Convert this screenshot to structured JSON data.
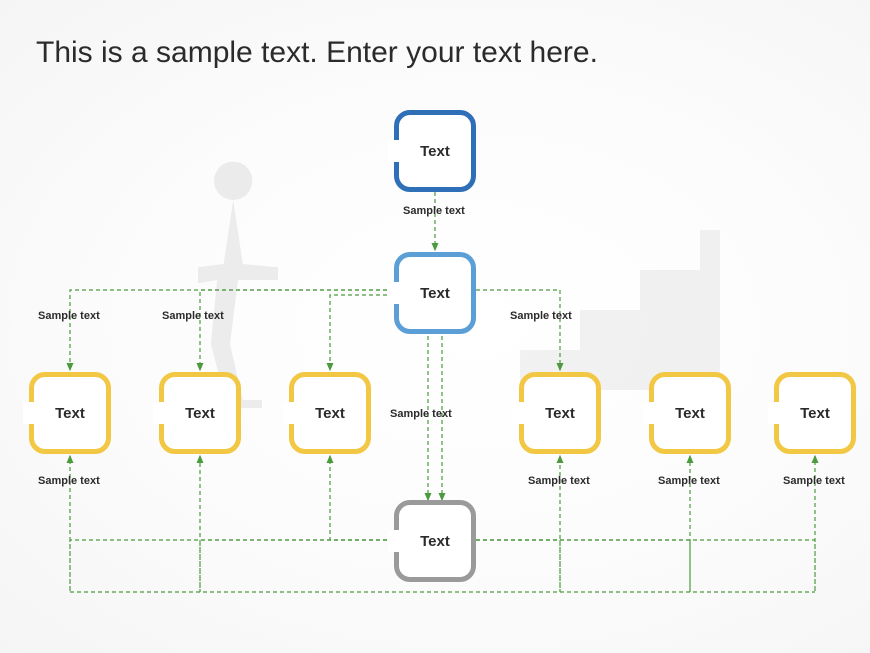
{
  "title": "This is a sample text. Enter your text here.",
  "nodes": {
    "top": "Text",
    "mid": "Text",
    "bottom": "Text",
    "y1": "Text",
    "y2": "Text",
    "y3": "Text",
    "y4": "Text",
    "y5": "Text",
    "y6": "Text"
  },
  "labels": {
    "top_mid": "Sample text",
    "mid_y1": "Sample text",
    "mid_y2": "Sample text",
    "mid_y4": "Sample text",
    "mid_bottom": "Sample text",
    "bottom_y1": "Sample text",
    "bottom_y4": "Sample text",
    "bottom_y5": "Sample text",
    "bottom_y6": "Sample text"
  },
  "colors": {
    "blue_dark": "#2f6fb7",
    "blue_light": "#5b9fd6",
    "yellow": "#f2c744",
    "gray": "#9a9a9a",
    "connector": "#4b9b3e"
  },
  "chart_data": {
    "type": "flow-tree",
    "title": "This is a sample text. Enter your text here.",
    "nodes": [
      {
        "id": "top",
        "label": "Text",
        "color": "blue_dark",
        "level": 0
      },
      {
        "id": "mid",
        "label": "Text",
        "color": "blue_light",
        "level": 1
      },
      {
        "id": "y1",
        "label": "Text",
        "color": "yellow",
        "level": 2
      },
      {
        "id": "y2",
        "label": "Text",
        "color": "yellow",
        "level": 2
      },
      {
        "id": "y3",
        "label": "Text",
        "color": "yellow",
        "level": 2
      },
      {
        "id": "y4",
        "label": "Text",
        "color": "yellow",
        "level": 2
      },
      {
        "id": "y5",
        "label": "Text",
        "color": "yellow",
        "level": 2
      },
      {
        "id": "y6",
        "label": "Text",
        "color": "yellow",
        "level": 2
      },
      {
        "id": "bottom",
        "label": "Text",
        "color": "gray",
        "level": 3
      }
    ],
    "edges": [
      {
        "from": "top",
        "to": "mid",
        "label": "Sample text"
      },
      {
        "from": "mid",
        "to": "y1",
        "label": "Sample text"
      },
      {
        "from": "mid",
        "to": "y2",
        "label": "Sample text"
      },
      {
        "from": "mid",
        "to": "y3",
        "label": null
      },
      {
        "from": "mid",
        "to": "y4",
        "label": "Sample text"
      },
      {
        "from": "mid",
        "to": "bottom",
        "label": "Sample text"
      },
      {
        "from": "bottom",
        "to": "y1",
        "label": "Sample text"
      },
      {
        "from": "bottom",
        "to": "y2",
        "label": null
      },
      {
        "from": "bottom",
        "to": "y3",
        "label": null
      },
      {
        "from": "bottom",
        "to": "y4",
        "label": "Sample text"
      },
      {
        "from": "bottom",
        "to": "y5",
        "label": "Sample text"
      },
      {
        "from": "bottom",
        "to": "y6",
        "label": "Sample text"
      }
    ]
  }
}
